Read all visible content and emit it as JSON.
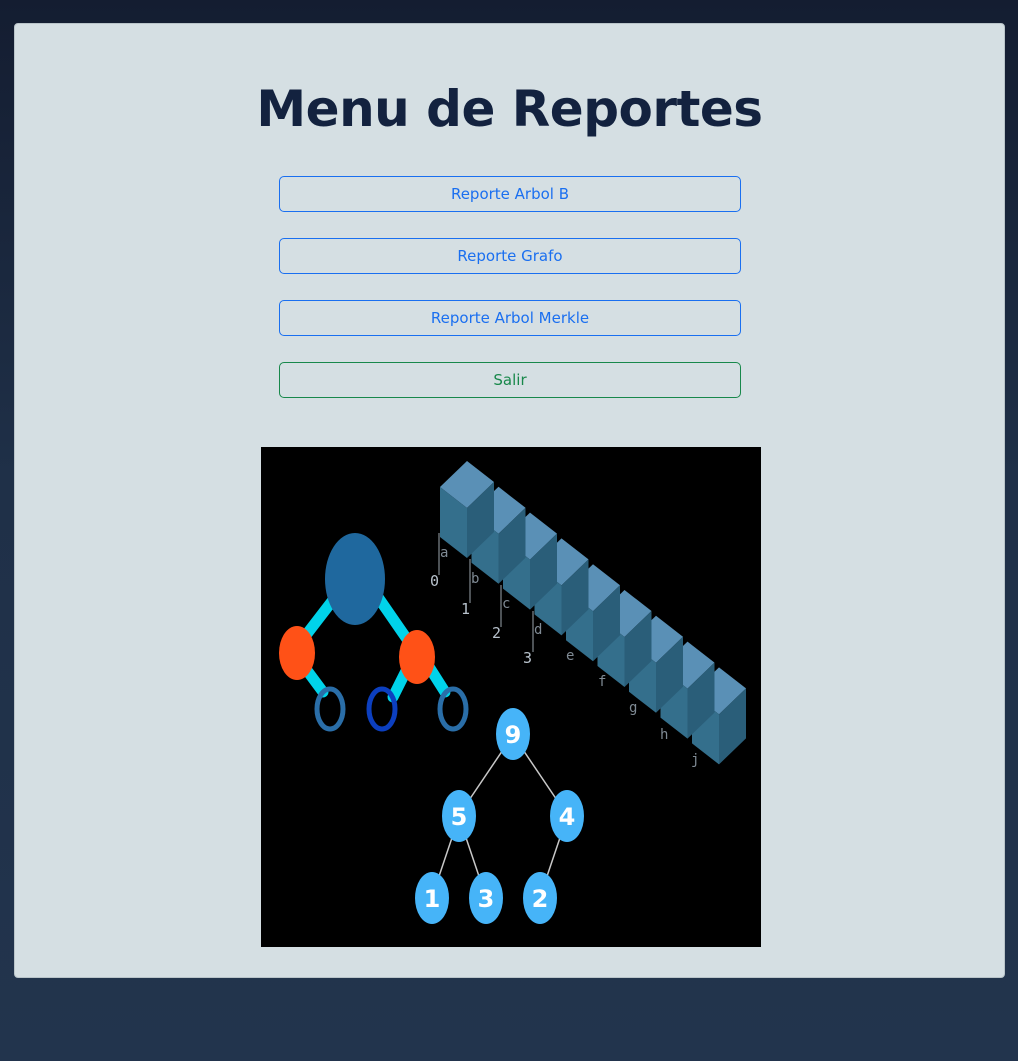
{
  "page": {
    "title": "Menu de Reportes"
  },
  "menu": {
    "buttons": [
      {
        "label": "Reporte Arbol B"
      },
      {
        "label": "Reporte Grafo"
      },
      {
        "label": "Reporte Arbol Merkle"
      },
      {
        "label": "Salir"
      }
    ]
  },
  "illustration": {
    "array_indices": [
      "0",
      "1",
      "2",
      "3"
    ],
    "array_letters": [
      "a",
      "b",
      "c",
      "d",
      "e",
      "f",
      "g",
      "h",
      "j"
    ],
    "heap_nodes": [
      "9",
      "5",
      "4",
      "1",
      "3",
      "2"
    ]
  },
  "colors": {
    "title": "#13223f",
    "primary": "#1a6ff0",
    "success": "#18884b",
    "card": "#d5dfe3"
  }
}
